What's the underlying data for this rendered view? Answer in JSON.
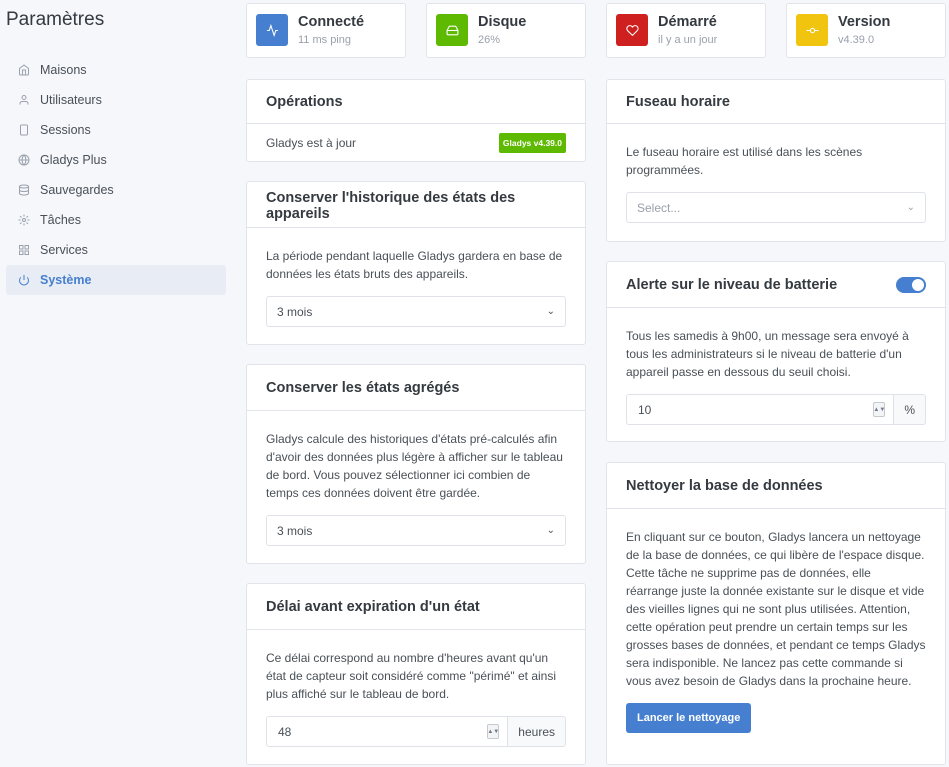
{
  "page_title": "Paramètres",
  "sidebar": {
    "items": [
      {
        "label": "Maisons",
        "icon": "home-icon"
      },
      {
        "label": "Utilisateurs",
        "icon": "user-icon"
      },
      {
        "label": "Sessions",
        "icon": "smartphone-icon"
      },
      {
        "label": "Gladys Plus",
        "icon": "globe-icon"
      },
      {
        "label": "Sauvegardes",
        "icon": "database-icon"
      },
      {
        "label": "Tâches",
        "icon": "settings-icon"
      },
      {
        "label": "Services",
        "icon": "grid-icon"
      },
      {
        "label": "Système",
        "icon": "power-icon",
        "active": true
      }
    ]
  },
  "stats": [
    {
      "title": "Connecté",
      "subtitle": "11 ms ping",
      "color": "#467fcf",
      "icon": "activity-icon"
    },
    {
      "title": "Disque",
      "subtitle": "26%",
      "color": "#5eba00",
      "icon": "hard-drive-icon"
    },
    {
      "title": "Démarré",
      "subtitle": "il y a un jour",
      "color": "#cd201f",
      "icon": "heart-icon"
    },
    {
      "title": "Version",
      "subtitle": "v4.39.0",
      "color": "#f1c40f",
      "icon": "git-commit-icon"
    }
  ],
  "operations": {
    "title": "Opérations",
    "status": "Gladys est à jour",
    "badge": "Gladys v4.39.0"
  },
  "history": {
    "title": "Conserver l'historique des états des appareils",
    "description": "La période pendant laquelle Gladys gardera en base de données les états bruts des appareils.",
    "selected": "3 mois"
  },
  "aggregated": {
    "title": "Conserver les états agrégés",
    "description": "Gladys calcule des historiques d'états pré-calculés afin d'avoir des données plus légère à afficher sur le tableau de bord. Vous pouvez sélectionner ici combien de temps ces données doivent être gardée.",
    "selected": "3 mois"
  },
  "expiration": {
    "title": "Délai avant expiration d'un état",
    "description": "Ce délai correspond au nombre d'heures avant qu'un état de capteur soit considéré comme \"périmé\" et ainsi plus affiché sur le tableau de bord.",
    "value": "48",
    "unit": "heures"
  },
  "timezone": {
    "title": "Fuseau horaire",
    "description": "Le fuseau horaire est utilisé dans les scènes programmées.",
    "placeholder": "Select..."
  },
  "battery": {
    "title": "Alerte sur le niveau de batterie",
    "enabled": true,
    "description": "Tous les samedis à 9h00, un message sera envoyé à tous les administrateurs si le niveau de batterie d'un appareil passe en dessous du seuil choisi.",
    "value": "10",
    "unit": "%"
  },
  "cleanup": {
    "title": "Nettoyer la base de données",
    "description": "En cliquant sur ce bouton, Gladys lancera un nettoyage de la base de données, ce qui libère de l'espace disque. Cette tâche ne supprime pas de données, elle réarrange juste la donnée existante sur le disque et vide des vieilles lignes qui ne sont plus utilisées. Attention, cette opération peut prendre un certain temps sur les grosses bases de données, et pendant ce temps Gladys sera indisponible. Ne lancez pas cette commande si vous avez besoin de Gladys dans la prochaine heure.",
    "button": "Lancer le nettoyage"
  }
}
